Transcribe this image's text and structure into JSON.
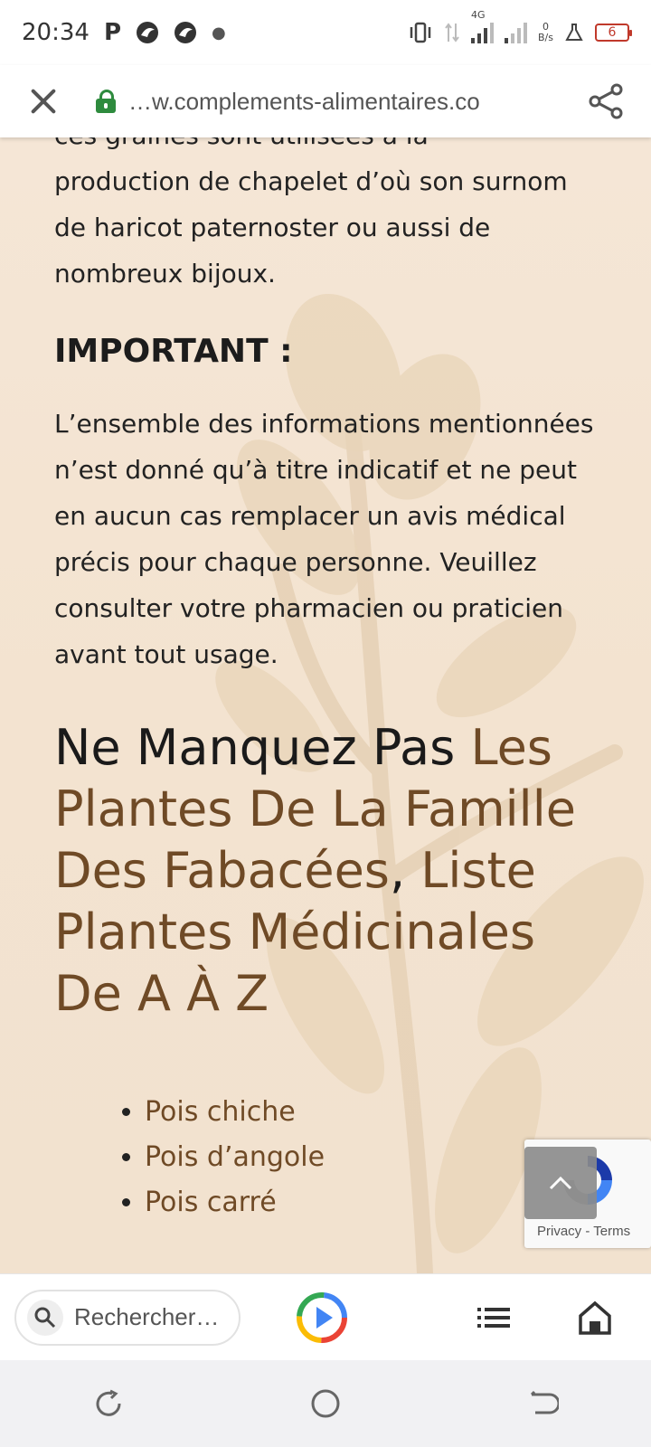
{
  "status_bar": {
    "time": "20:34",
    "network_type": "4G",
    "net_speed_value": "0",
    "net_speed_unit": "B/s",
    "battery_level": "6"
  },
  "browser": {
    "url": "…w.complements-alimentaires.co"
  },
  "article": {
    "paragraph_top_partial": "ces graines sont utilisées à la",
    "paragraph_top": "production de chapelet d’où son surnom de haricot paternoster ou aussi de nombreux bijoux.",
    "important_title": "IMPORTANT :",
    "important_text": "L’ensemble des informations mentionnées n’est donné qu’à titre indicatif et ne peut en aucun cas remplacer un avis médical précis pour chaque personne. Veuillez consulter votre pharmacien ou praticien avant tout usage.",
    "heading_prefix": "Ne Manquez Pas ",
    "link_fabacees": "Les Plantes De La Famille Des Fabacées",
    "heading_separator": ", ",
    "link_plantes": "Liste Plantes Médicinales De A À Z",
    "list_items": [
      "Pois chiche",
      "Pois d’angole",
      "Pois carré"
    ]
  },
  "recaptcha": {
    "privacy": "Privacy",
    "separator": " - ",
    "terms": "Terms"
  },
  "bottom_bar": {
    "search_placeholder": "Rechercher…"
  },
  "colors": {
    "link": "#6f4a26",
    "background": "#f5e6d6",
    "lock": "#2e8b3e",
    "battery": "#c0392b"
  }
}
